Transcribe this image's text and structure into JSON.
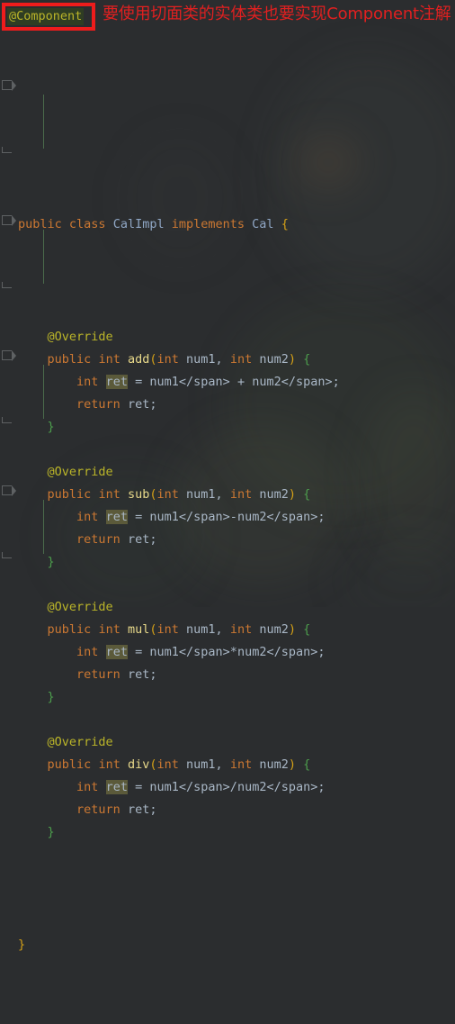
{
  "editor": {
    "theme": "darcula",
    "background_color": "#2b2d2f",
    "foreground_color": "#a9b7c6",
    "indent_guide_color": "#4b6b4b",
    "identifier_highlight_color": "#5b5a3a",
    "highlighted_identifier": "ret"
  },
  "annotation": {
    "chip_text": "@Component",
    "chip_bg_color": "#2f3d23",
    "chip_text_color": "#bbb529",
    "box_color": "#ee1c1c",
    "note_text": "要使用切面类的实体类也要实现Component注解",
    "note_color": "#e02020"
  },
  "code": {
    "class_declaration": {
      "kw_public": "public",
      "kw_class": "class",
      "class_name": "CalImpl",
      "kw_implements": "implements",
      "interface_name": "Cal",
      "open_brace": "{"
    },
    "override_label": "@Override",
    "kw_public": "public",
    "kw_int": "int",
    "kw_return": "return",
    "var_ret": "ret",
    "param1": "num1",
    "param2": "num2",
    "open_paren": "(",
    "close_paren": ")",
    "comma": ",",
    "open_brace": "{",
    "close_brace": "}",
    "assign": "=",
    "semicolon": ";",
    "class_close_brace": "}",
    "methods": [
      {
        "name": "add",
        "expression": "num1 + num2"
      },
      {
        "name": "sub",
        "expression": "num1-num2"
      },
      {
        "name": "mul",
        "expression": "num1*num2"
      },
      {
        "name": "div",
        "expression": "num1/num2"
      }
    ]
  }
}
